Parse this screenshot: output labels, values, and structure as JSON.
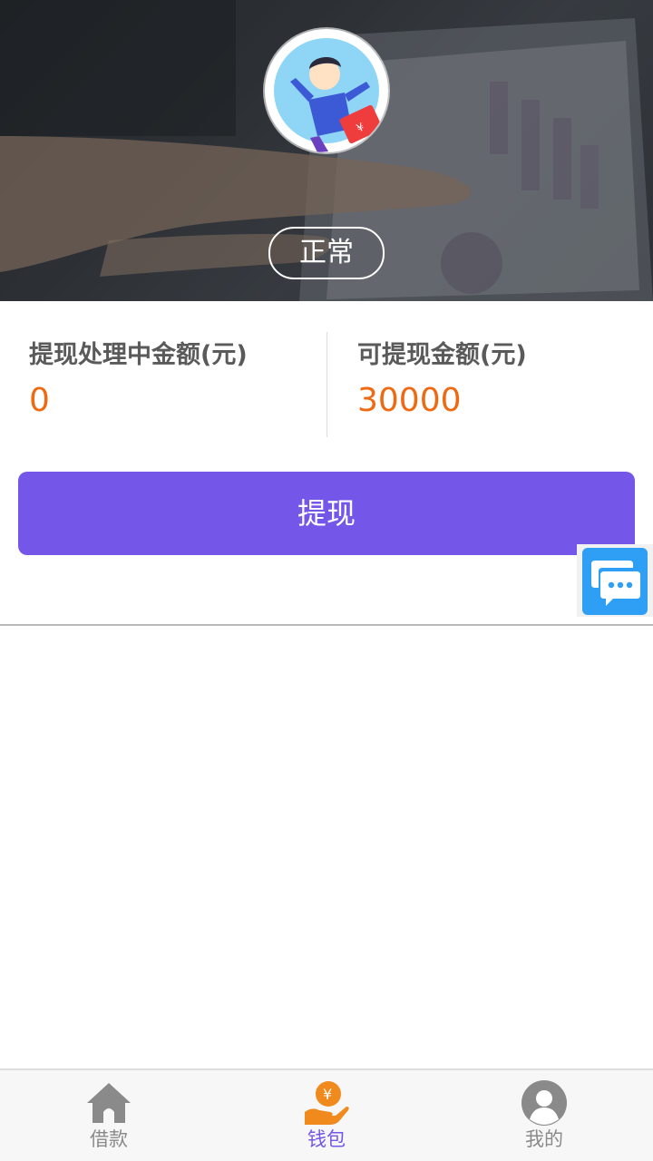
{
  "header": {
    "status": "正常"
  },
  "amounts": {
    "processing": {
      "label": "提现处理中金额(元)",
      "value": "0"
    },
    "available": {
      "label": "可提现金额(元)",
      "value": "30000"
    }
  },
  "actions": {
    "withdraw_label": "提现"
  },
  "chat": {
    "icon": "chat-bubble-icon"
  },
  "tabbar": {
    "items": [
      {
        "label": "借款",
        "icon": "home-icon",
        "active": false
      },
      {
        "label": "钱包",
        "icon": "wallet-yen-icon",
        "active": true
      },
      {
        "label": "我的",
        "icon": "user-icon",
        "active": false
      }
    ]
  },
  "colors": {
    "accent": "#7456e8",
    "amount": "#ee6a12",
    "chat": "#2e9ff5",
    "wallet_icon": "#f08a1c"
  }
}
